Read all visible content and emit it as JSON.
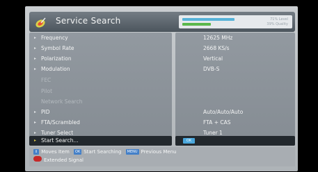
{
  "header": {
    "title": "Service Search",
    "logo_icon": "satellite-dish-icon",
    "signal": {
      "level_text": "71% Level",
      "quality_text": "39% Quality",
      "level": 0.71,
      "quality": 0.39,
      "level_color": "#56b2d8",
      "quality_color": "#5bb84c"
    }
  },
  "rows": [
    {
      "label": "Frequency",
      "value": "12625 MHz"
    },
    {
      "label": "Symbol Rate",
      "value": "2668 KS/s"
    },
    {
      "label": "Polarization",
      "value": "Vertical"
    },
    {
      "label": "Modulation",
      "value": "DVB-S"
    },
    {
      "label": "FEC",
      "value": ""
    },
    {
      "label": "Pilot",
      "value": ""
    },
    {
      "label": "Network Search",
      "value": ""
    },
    {
      "label": "PID",
      "value": "Auto/Auto/Auto"
    },
    {
      "label": "FTA/Scrambled",
      "value": "FTA + CAS"
    },
    {
      "label": "Tuner Select",
      "value": "Tuner 1"
    }
  ],
  "start": {
    "label": "Start Search...",
    "ok_label": "OK"
  },
  "help": {
    "move_key": "⇕",
    "move_text": "Moves Item",
    "ok_key": "OK",
    "ok_text": "Start Searching",
    "menu_key": "MENU",
    "menu_text": "Previous Menu",
    "extended_text": "Extended Signal",
    "red_color": "#c62828"
  }
}
